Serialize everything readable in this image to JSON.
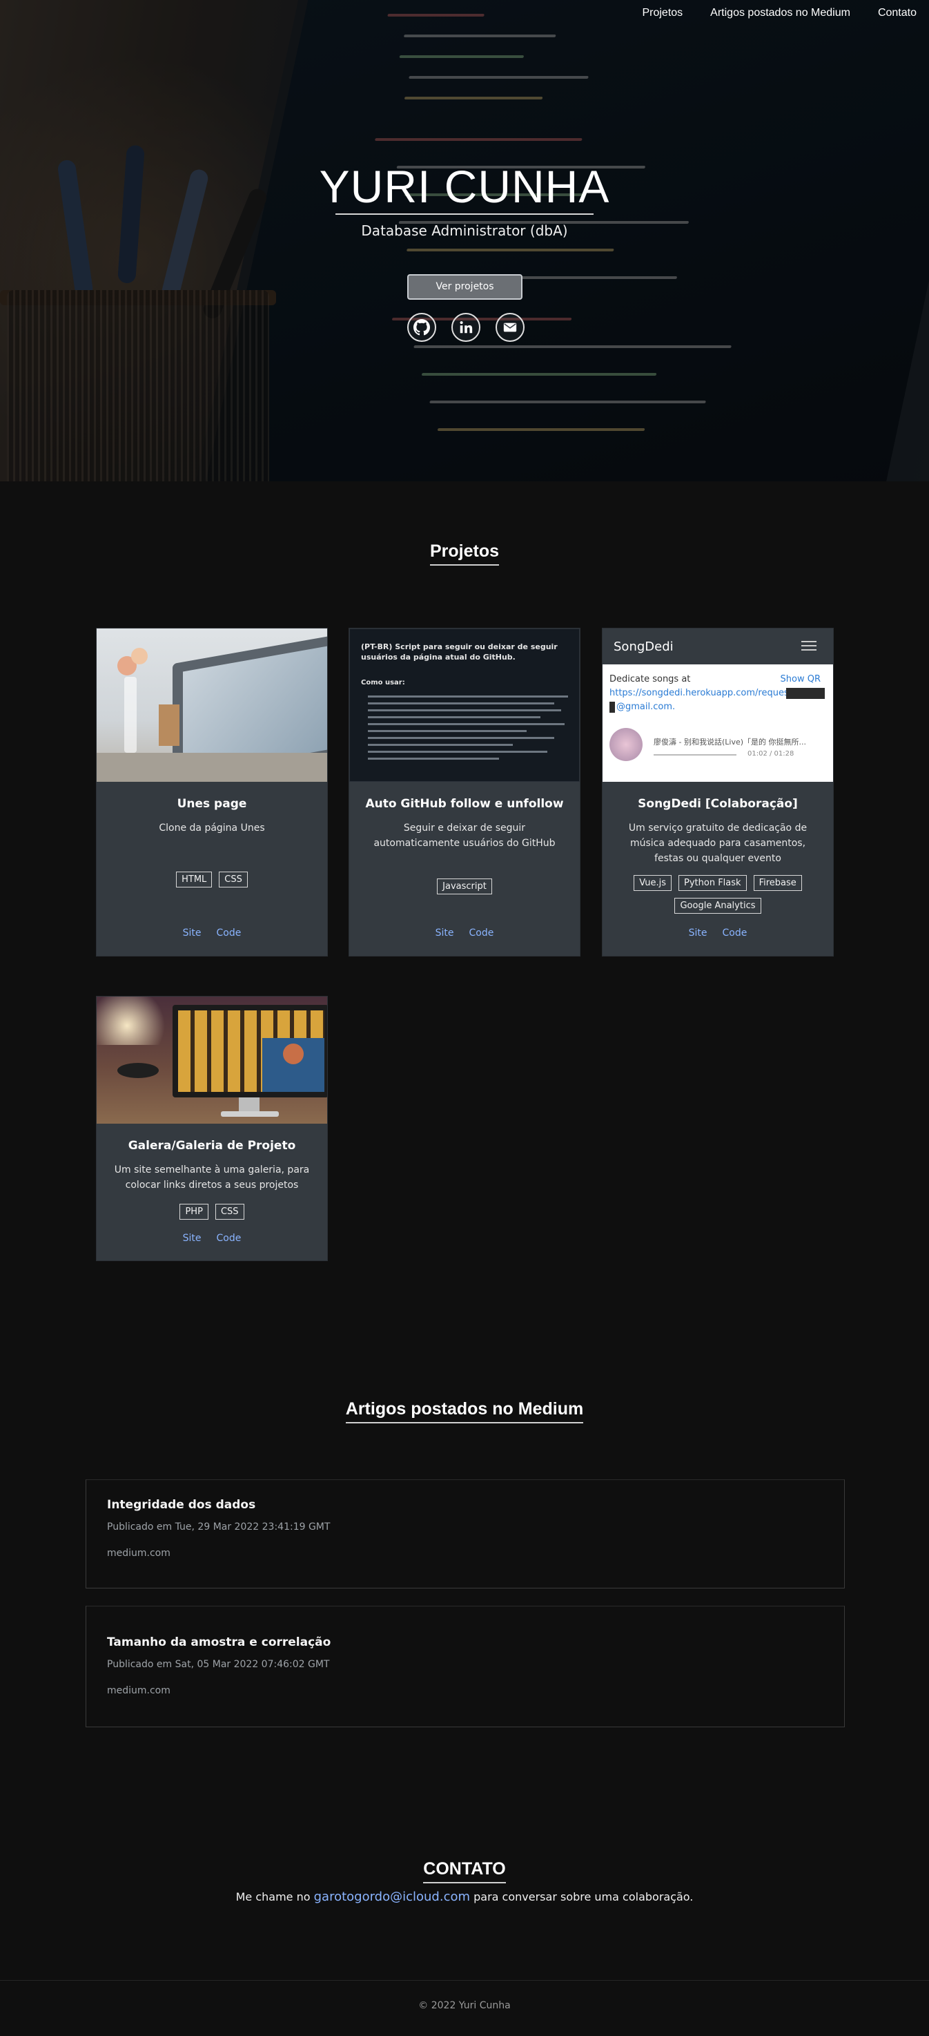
{
  "nav": {
    "items": [
      {
        "label": "Projetos"
      },
      {
        "label": "Artigos postados no Medium"
      },
      {
        "label": "Contato"
      }
    ]
  },
  "hero": {
    "name": "YURI CUNHA",
    "role": "Database Administrator (dbA)",
    "cta_label": "Ver projetos",
    "socials": [
      {
        "icon": "github-icon"
      },
      {
        "icon": "linkedin-icon"
      },
      {
        "icon": "email-icon"
      }
    ]
  },
  "projects": {
    "title": "Projetos",
    "items": [
      {
        "title": "Unes page",
        "description": "Clone da página Unes",
        "tags": [
          "HTML",
          "CSS"
        ],
        "site_label": "Site",
        "code_label": "Code"
      },
      {
        "title": "Auto GitHub follow e unfollow",
        "description": "Seguir e deixar de seguir automaticamente usuários do GitHub",
        "tags": [
          "Javascript"
        ],
        "site_label": "Site",
        "code_label": "Code",
        "thumb": {
          "heading": "(PT-BR) Script para seguir ou deixar de seguir usuários da página atual do GitHub.",
          "subheading": "Como usar:"
        }
      },
      {
        "title": "SongDedi [Colaboração]",
        "description": "Um serviço gratuito de dedicação de música adequado para casamentos, festas ou qualquer evento",
        "tags": [
          "Vue.js",
          "Python Flask",
          "Firebase",
          "Google Analytics"
        ],
        "site_label": "Site",
        "code_label": "Code",
        "thumb": {
          "app_name": "SongDedi",
          "line1": "Dedicate songs at",
          "qr": "Show QR",
          "link1": "https://songdedi.herokuapp.com/request",
          "link2": "@gmail.com.",
          "song": "廖俊濤 - 别和我说話(Live)「是的 你挺無所...",
          "time": "01:02 / 01:28"
        }
      },
      {
        "title": "Galera/Galeria de Projeto",
        "description": "Um site semelhante à uma galeria, para colocar links diretos a seus projetos",
        "tags": [
          "PHP",
          "CSS"
        ],
        "site_label": "Site",
        "code_label": "Code"
      }
    ]
  },
  "articles": {
    "title": "Artigos postados no Medium",
    "items": [
      {
        "title": "Integridade dos dados",
        "date": "Publicado em Tue, 29 Mar 2022 23:41:19 GMT",
        "source": "medium.com"
      },
      {
        "title": "Tamanho da amostra e correlação",
        "date": "Publicado em Sat, 05 Mar 2022 07:46:02 GMT",
        "source": "medium.com"
      }
    ]
  },
  "contact": {
    "title": "CONTATO",
    "prefix": "Me chame no",
    "email": "garotogordo@icloud.com",
    "suffix": "para conversar sobre uma colaboração."
  },
  "footer": {
    "text": "© 2022 Yuri Cunha"
  },
  "colors": {
    "background": "#0f0f0f",
    "card": "#343a40",
    "link": "#8ab4ff"
  }
}
